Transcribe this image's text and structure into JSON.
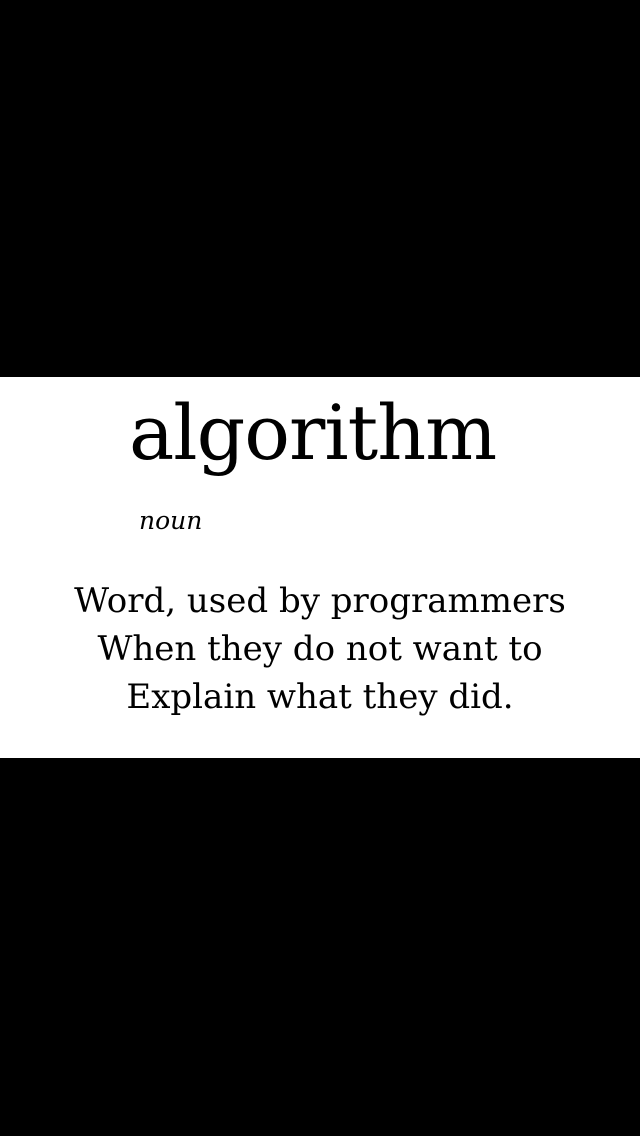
{
  "entry": {
    "word": "algorithm",
    "part_of_speech": "noun",
    "definition_lines": [
      "Word, used by programmers",
      "When they do not want to",
      "Explain what they did."
    ]
  },
  "colors": {
    "background": "#000000",
    "card": "#ffffff",
    "text": "#000000"
  }
}
